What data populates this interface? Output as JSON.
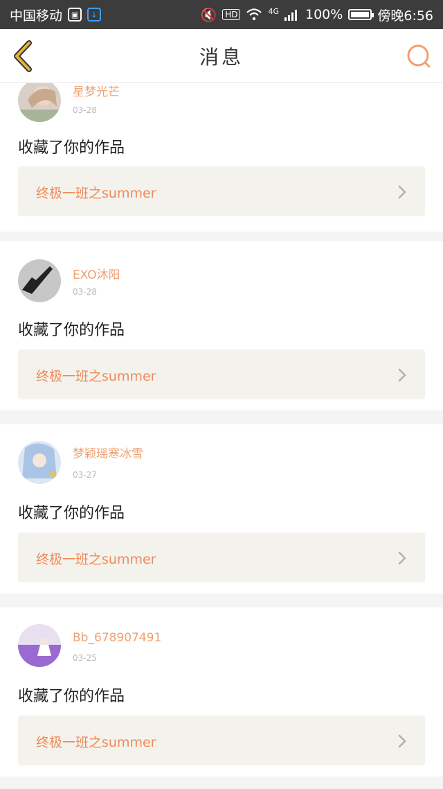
{
  "status_bar": {
    "carrier": "中国移动",
    "network": "4G",
    "hd": "HD",
    "battery": "100%",
    "time": "傍晚6:56"
  },
  "nav": {
    "title": "消息",
    "back_icon": "chevron-left-icon",
    "search_icon": "search-icon"
  },
  "colors": {
    "accent": "#f08a58",
    "username": "#f0a070",
    "back": "#e8b43a",
    "search": "#f0a070",
    "work_bg": "#f4f2ec"
  },
  "messages": [
    {
      "username": "星梦光芒",
      "date": "03-28",
      "action": "收藏了你的作品",
      "work_title": "终极一班之summer",
      "avatar": "girl-photo-avatar"
    },
    {
      "username": "EXO沐阳",
      "date": "03-28",
      "action": "收藏了你的作品",
      "work_title": "终极一班之summer",
      "avatar": "hand-gesture-avatar"
    },
    {
      "username": "梦颖瑶寒冰雪",
      "date": "03-27",
      "action": "收藏了你的作品",
      "work_title": "终极一班之summer",
      "avatar": "anime-girl-avatar"
    },
    {
      "username": "Bb_678907491",
      "date": "03-25",
      "action": "收藏了你的作品",
      "work_title": "终极一班之summer",
      "avatar": "lavender-field-avatar"
    }
  ]
}
